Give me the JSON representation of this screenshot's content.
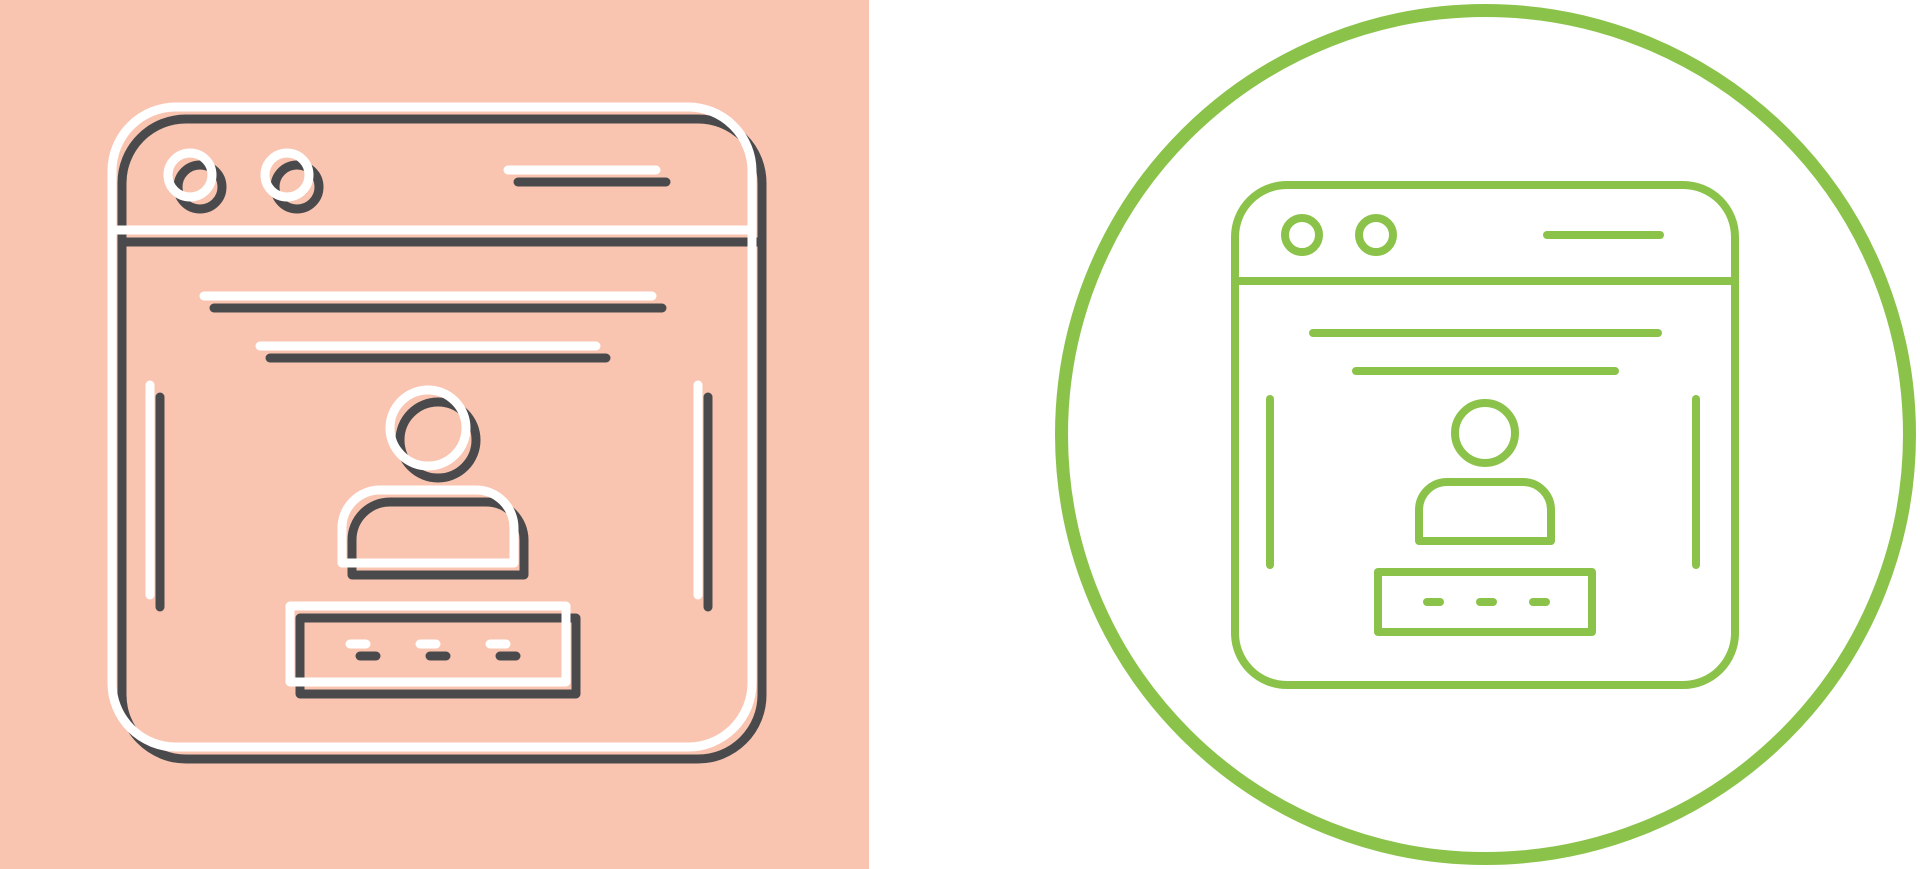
{
  "icons": [
    {
      "name": "web-login-icon-glyph-style",
      "background": "#f9c5b1",
      "stroke_front": "#ffffff",
      "stroke_shadow": "#4a4a4d"
    },
    {
      "name": "web-login-icon-line-style",
      "background": "#ffffff",
      "stroke": "#8bc34a",
      "ring": "#8bc34a"
    }
  ]
}
